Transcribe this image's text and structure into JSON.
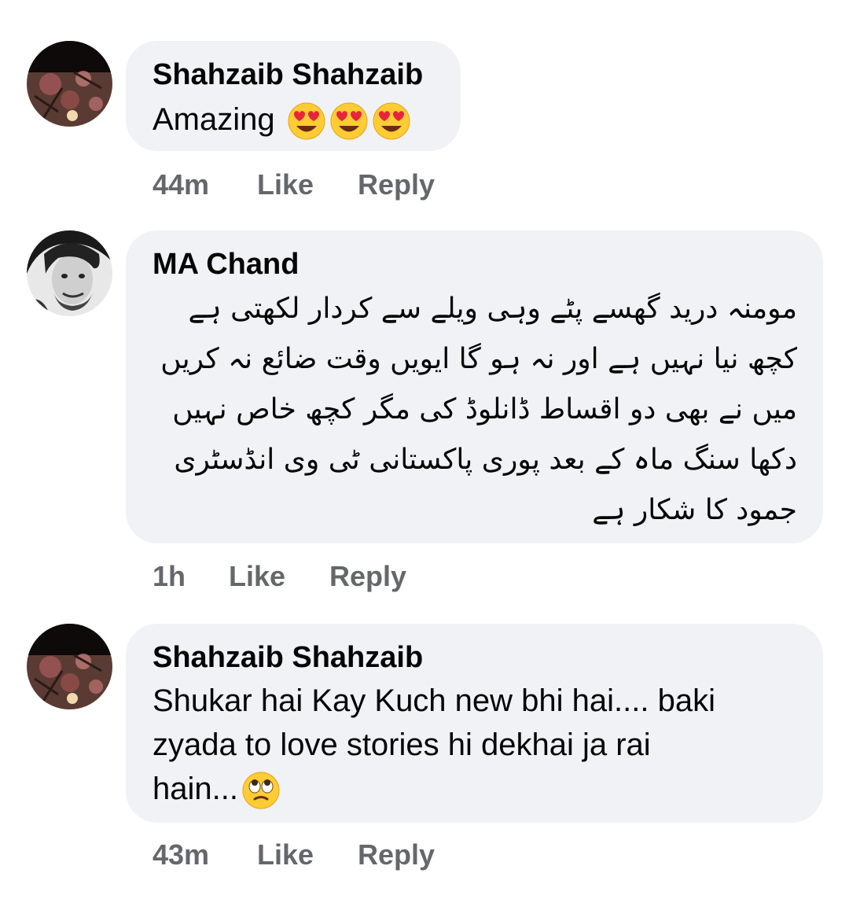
{
  "comments": [
    {
      "author": "Shahzaib Shahzaib",
      "text": "Amazing",
      "emoji": [
        "heart-eyes-emoji",
        "heart-eyes-emoji",
        "heart-eyes-emoji"
      ],
      "time": "44m",
      "like": "Like",
      "reply": "Reply"
    },
    {
      "author": "MA Chand",
      "text": "مومنہ درید گھسے پٹے وہی ویلے سے کردار لکھتی ہے کچھ نیا نہیں ہے اور نہ ہو گا ایویں وقت ضائع نہ کریں میں نے بھی دو اقساط ڈانلوڈ کی مگر کچھ خاص نہیں دکھا سنگ ماہ کے بعد پوری پاکستانی ٹی وی انڈسٹری جمود کا شکار ہے",
      "time": "1h",
      "like": "Like",
      "reply": "Reply"
    },
    {
      "author": "Shahzaib Shahzaib",
      "text_lines": [
        "Shukar hai Kay Kuch new bhi hai.... baki",
        "zyada to love stories hi dekhai ja rai",
        "hain..."
      ],
      "emoji": [
        "eye-roll-emoji"
      ],
      "time": "43m",
      "like": "Like",
      "reply": "Reply"
    }
  ],
  "colors": {
    "bubble": "#f0f2f5",
    "meta": "#65676b",
    "text": "#050505"
  }
}
